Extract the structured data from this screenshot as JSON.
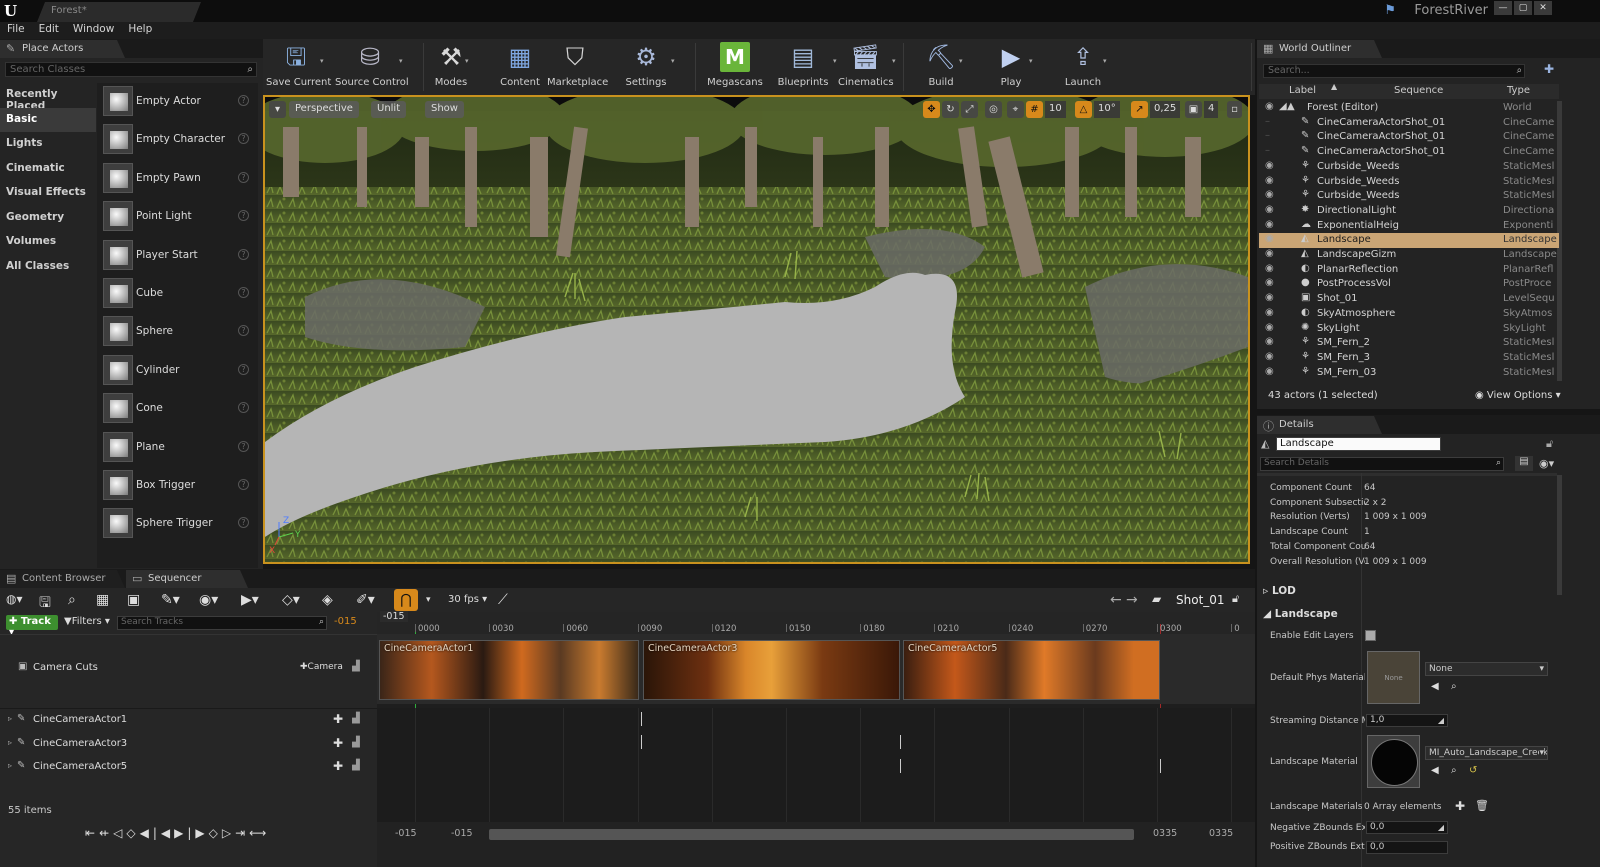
{
  "titlebar": {
    "doc_tab": "Forest*",
    "project": "ForestRiver"
  },
  "menu": [
    "File",
    "Edit",
    "Window",
    "Help"
  ],
  "place_actors": {
    "tab": "Place Actors",
    "search_placeholder": "Search Classes",
    "categories": [
      "Recently Placed",
      "Basic",
      "Lights",
      "Cinematic",
      "Visual Effects",
      "Geometry",
      "Volumes",
      "All Classes"
    ],
    "selected_category": "Basic",
    "actors": [
      "Empty Actor",
      "Empty Character",
      "Empty Pawn",
      "Point Light",
      "Player Start",
      "Cube",
      "Sphere",
      "Cylinder",
      "Cone",
      "Plane",
      "Box Trigger",
      "Sphere Trigger"
    ]
  },
  "toolbar": [
    {
      "label": "Save Current",
      "icon": "save-icon"
    },
    {
      "label": "Source Control",
      "icon": "source-control-icon"
    },
    {
      "label": "Modes",
      "icon": "modes-icon"
    },
    {
      "label": "Content",
      "icon": "content-icon"
    },
    {
      "label": "Marketplace",
      "icon": "marketplace-icon"
    },
    {
      "label": "Settings",
      "icon": "settings-icon"
    },
    {
      "label": "Megascans",
      "icon": "megascans-icon"
    },
    {
      "label": "Blueprints",
      "icon": "blueprints-icon"
    },
    {
      "label": "Cinematics",
      "icon": "cinematics-icon"
    },
    {
      "label": "Build",
      "icon": "build-icon"
    },
    {
      "label": "Play",
      "icon": "play-icon"
    },
    {
      "label": "Launch",
      "icon": "launch-icon"
    }
  ],
  "viewport": {
    "perspective": "Perspective",
    "lit": "Unlit",
    "show": "Show",
    "grid_snap": "10",
    "rot_snap": "10°",
    "scale_snap": "0,25",
    "cam_speed": "4"
  },
  "outliner": {
    "tab": "World Outliner",
    "search_placeholder": "Search...",
    "col_label": "Label",
    "col_sequence": "Sequence",
    "col_type": "Type",
    "rows": [
      {
        "label": "Forest (Editor)",
        "type": "World",
        "indent": 0
      },
      {
        "label": "CineCameraActorShot_01",
        "type": "CineCame",
        "indent": 1
      },
      {
        "label": "CineCameraActorShot_01",
        "type": "CineCame",
        "indent": 1
      },
      {
        "label": "CineCameraActorShot_01",
        "type": "CineCame",
        "indent": 1
      },
      {
        "label": "Curbside_Weeds",
        "type": "StaticMesl",
        "indent": 1
      },
      {
        "label": "Curbside_Weeds",
        "type": "StaticMesl",
        "indent": 1
      },
      {
        "label": "Curbside_Weeds",
        "type": "StaticMesl",
        "indent": 1
      },
      {
        "label": "DirectionalLight",
        "type": "Directiona",
        "indent": 1
      },
      {
        "label": "ExponentialHeig",
        "type": "Exponenti",
        "indent": 1
      },
      {
        "label": "Landscape",
        "type": "Landscape",
        "indent": 1,
        "selected": true
      },
      {
        "label": "LandscapeGizm",
        "type": "Landscape",
        "indent": 1
      },
      {
        "label": "PlanarReflection",
        "type": "PlanarRefl",
        "indent": 1
      },
      {
        "label": "PostProcessVol",
        "type": "PostProce",
        "indent": 1
      },
      {
        "label": "Shot_01",
        "type": "LevelSequ",
        "indent": 1
      },
      {
        "label": "SkyAtmosphere",
        "type": "SkyAtmos",
        "indent": 1
      },
      {
        "label": "SkyLight",
        "type": "SkyLight",
        "indent": 1
      },
      {
        "label": "SM_Fern_2",
        "type": "StaticMesl",
        "indent": 1
      },
      {
        "label": "SM_Fern_3",
        "type": "StaticMesl",
        "indent": 1
      },
      {
        "label": "SM_Fern_03",
        "type": "StaticMesl",
        "indent": 1
      }
    ],
    "footer": "43 actors (1 selected)",
    "view_options": "View Options"
  },
  "details": {
    "tab": "Details",
    "name": "Landscape",
    "search_placeholder": "Search Details",
    "props": [
      {
        "k": "Component Count",
        "v": "64"
      },
      {
        "k": "Component Subsectic",
        "v": "2 x 2"
      },
      {
        "k": "Resolution (Verts)",
        "v": "1 009 x 1 009"
      },
      {
        "k": "Landscape Count",
        "v": "1"
      },
      {
        "k": "Total Component Cou",
        "v": "64"
      },
      {
        "k": "Overall Resolution (Ve",
        "v": "1 009 x 1 009"
      }
    ],
    "lod": "LOD",
    "landscape_section": "Landscape",
    "enable_edit_layers": "Enable Edit Layers",
    "default_phys": "Default Phys Material",
    "phys_thumb": "None",
    "phys_value": "None",
    "streaming": "Streaming Distance M",
    "streaming_val": "1,0",
    "landscape_material": "Landscape Material",
    "material_value": "MI_Auto_Landscape_Creek",
    "landscape_materials": "Landscape Materials (",
    "array_elements": "0 Array elements",
    "neg_z": "Negative ZBounds Ext",
    "neg_z_val": "0,0",
    "pos_z": "Positive ZBounds Ext",
    "pos_z_val": "0,0"
  },
  "bottom": {
    "tab_content": "Content Browser",
    "tab_sequencer": "Sequencer",
    "fps": "30 fps",
    "shot": "Shot_01",
    "track_btn": "Track",
    "filters": "Filters",
    "search_tracks": "Search Tracks",
    "current_frame": "-015",
    "camera_cuts": "Camera Cuts",
    "camera_btn": "Camera",
    "tracks": [
      "CineCameraActor1",
      "CineCameraActor3",
      "CineCameraActor5"
    ],
    "items": "55 items",
    "range_start": "-015",
    "range_start2": "-015",
    "range_end": "0335",
    "range_end2": "0335",
    "ticks": [
      "0000",
      "0030",
      "0060",
      "0090",
      "0120",
      "0150",
      "0180",
      "0210",
      "0240",
      "0270",
      "0300",
      "0"
    ],
    "playhead": "-015",
    "clips": [
      "CineCameraActor1",
      "CineCameraActor3",
      "CineCameraActor5"
    ]
  }
}
